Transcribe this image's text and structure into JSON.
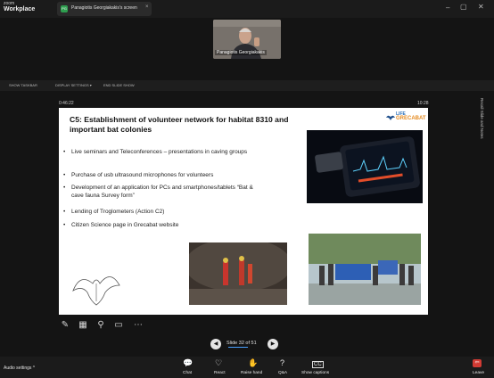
{
  "app": {
    "brand_line1": "zoom",
    "brand_line2": "Workplace"
  },
  "tab": {
    "icon_text": "PG",
    "label": "Panagiotis Georgiakakis's screen",
    "close": "×"
  },
  "window_controls": {
    "minimize": "–",
    "maximize": "▢",
    "close": "✕"
  },
  "participant": {
    "name": "Panagiotis Georgiakakis"
  },
  "presenter_toolbar": {
    "items": [
      "SHOW TASKBAR",
      "DISPLAY SETTINGS ▾",
      "END SLIDE SHOW"
    ]
  },
  "side_panel": {
    "label": "Recall Slide and Notes"
  },
  "timers": {
    "elapsed": "0:46:22",
    "clock": "10:28"
  },
  "slide": {
    "title": "C5: Establishment of volunteer network for habitat 8310 and important bat colonies",
    "logo": {
      "line1": "LIFE",
      "line2": "GRECABAT"
    },
    "bullets": [
      "Live seminars and Teleconferences – presentations in caving groups",
      "Purchase of usb ultrasound microphones for volunteers",
      "Development of an application for PCs and smartphones/tablets “Bat & cave fauna Survey form”",
      "Lending of Troglometers (Action C2)",
      "Citizen Science page in Grecabat website"
    ]
  },
  "slide_controls": {
    "counter": "Slide 32 of 51",
    "prev": "◀",
    "next": "▶"
  },
  "bottom_bar": {
    "audio_label": "Audio settings ^",
    "buttons": [
      {
        "label": "Chat",
        "icon": "chat-icon"
      },
      {
        "label": "React",
        "icon": "react-icon"
      },
      {
        "label": "Raise hand",
        "icon": "raise-hand-icon"
      },
      {
        "label": "Q&A",
        "icon": "qa-icon"
      },
      {
        "label": "Show captions",
        "icon": "captions-icon"
      }
    ],
    "leave_label": "Leave"
  }
}
